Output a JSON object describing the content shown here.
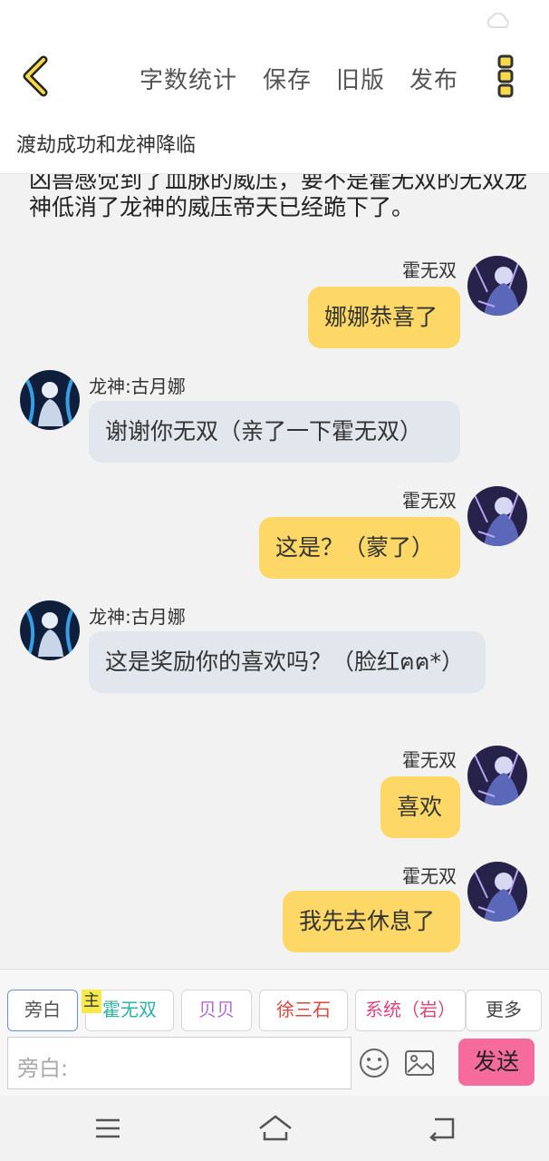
{
  "toolbar": {
    "word_count": "字数统计",
    "save": "保存",
    "old_version": "旧版",
    "publish": "发布"
  },
  "chapter": {
    "title": "渡劫成功和龙神降临"
  },
  "chat": {
    "narration": "凶兽感觉到了血脉的威压，要不是霍无双的无双龙神低消了龙神的威压帝天已经跪下了。",
    "messages": [
      {
        "side": "right",
        "speaker": "霍无双",
        "text": "娜娜恭喜了"
      },
      {
        "side": "left",
        "speaker": "龙神:古月娜",
        "text": "谢谢你无双（亲了一下霍无双）"
      },
      {
        "side": "right",
        "speaker": "霍无双",
        "text": "这是？（蒙了）"
      },
      {
        "side": "left",
        "speaker": "龙神:古月娜",
        "text": "这是奖励你的喜欢吗？（脸红ฅฅ*）"
      },
      {
        "side": "right",
        "speaker": "霍无双",
        "text": "喜欢"
      },
      {
        "side": "right",
        "speaker": "霍无双",
        "text": "我先去休息了"
      }
    ]
  },
  "characters": {
    "narrator": "旁白",
    "main_badge": "主",
    "c1": "霍无双",
    "c2": "贝贝",
    "c3": "徐三石",
    "c4": "系统（岩）",
    "more": "更多",
    "colors": {
      "c1": "#2bb3a6",
      "c2": "#b56ad2",
      "c3": "#e0443e",
      "c4": "#e0447a"
    }
  },
  "input": {
    "placeholder": "旁白:"
  },
  "send": {
    "label": "发送"
  },
  "accent": {
    "bubble_right": "#fdd866",
    "bubble_left": "#e2e7ee",
    "send": "#f56b9b"
  }
}
